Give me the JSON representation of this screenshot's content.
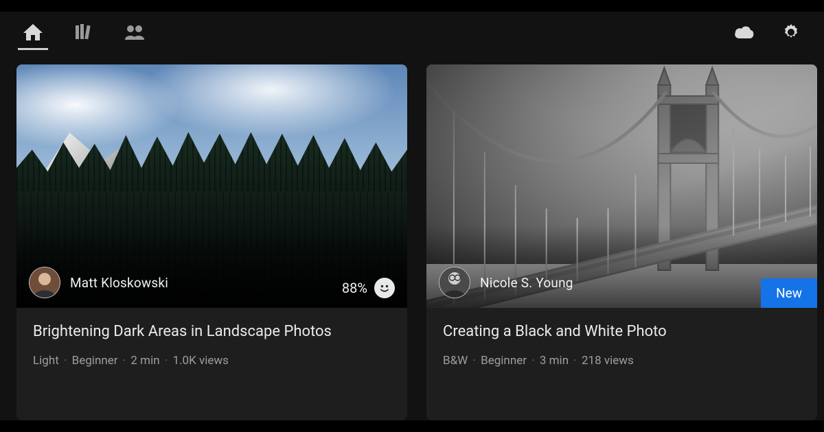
{
  "nav": {
    "active_index": 0,
    "items": [
      "home",
      "library",
      "community"
    ]
  },
  "cards": [
    {
      "author": "Matt Kloskowski",
      "rating_percent": "88%",
      "title": "Brightening Dark Areas in Landscape Photos",
      "category": "Light",
      "level": "Beginner",
      "duration": "2 min",
      "views": "1.0K views",
      "badge": null
    },
    {
      "author": "Nicole S. Young",
      "rating_percent": null,
      "title": "Creating a Black and White Photo",
      "category": "B&W",
      "level": "Beginner",
      "duration": "3 min",
      "views": "218 views",
      "badge": "New"
    }
  ],
  "colors": {
    "accent": "#1473e6",
    "bg": "#121212",
    "card": "#1e1e1e"
  }
}
